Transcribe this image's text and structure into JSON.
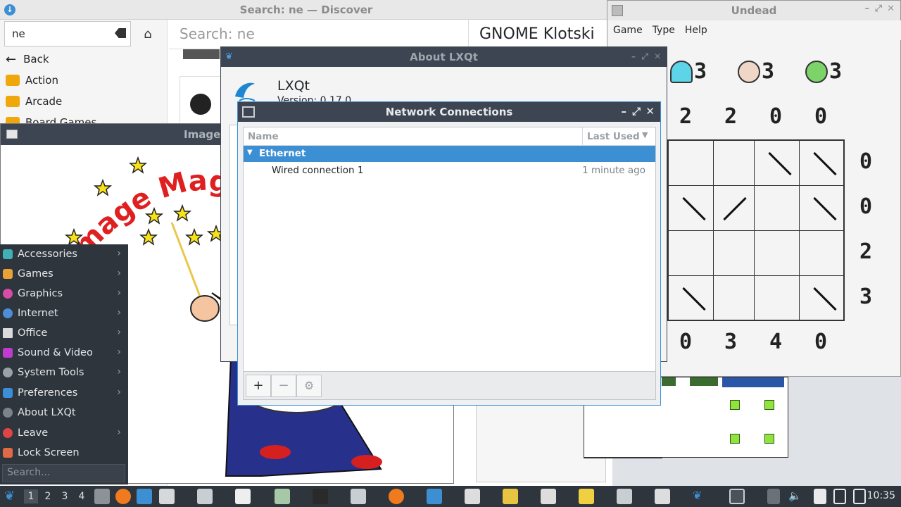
{
  "discover": {
    "title": "Search: ne — Discover",
    "search_value": "ne",
    "nav": [
      {
        "label": "Back",
        "icon": "back-arrow-icon"
      },
      {
        "label": "Action",
        "icon": "gamepad-icon"
      },
      {
        "label": "Arcade",
        "icon": "gamepad-icon"
      },
      {
        "label": "Board Games",
        "icon": "gamepad-icon"
      }
    ],
    "header_query": "Search: ne",
    "app_title": "GNOME Klotski"
  },
  "imagemagick": {
    "title": "Image",
    "banner_text": "mage Magi"
  },
  "menu": {
    "items": [
      {
        "label": "Accessories",
        "icon": "accessories-icon",
        "color": "#3fb0b6"
      },
      {
        "label": "Games",
        "icon": "games-icon",
        "color": "#e8a235"
      },
      {
        "label": "Graphics",
        "icon": "graphics-icon",
        "color": "#d64ca6"
      },
      {
        "label": "Internet",
        "icon": "internet-icon",
        "color": "#4d8ed8"
      },
      {
        "label": "Office",
        "icon": "office-icon",
        "color": "#d8dadd"
      },
      {
        "label": "Sound & Video",
        "icon": "sound-video-icon",
        "color": "#c03bd0"
      },
      {
        "label": "System Tools",
        "icon": "system-tools-icon",
        "color": "#9aa1a8"
      },
      {
        "label": "Preferences",
        "icon": "preferences-icon",
        "color": "#3a8fd8"
      },
      {
        "label": "About LXQt",
        "icon": "info-icon",
        "color": "#7c838b"
      },
      {
        "label": "Leave",
        "icon": "power-icon",
        "color": "#e04545"
      },
      {
        "label": "Lock Screen",
        "icon": "lock-icon",
        "color": "#e06a45"
      }
    ],
    "search_placeholder": "Search..."
  },
  "undead": {
    "title": "Undead",
    "menubar": [
      "Game",
      "Type",
      "Help"
    ],
    "counts": {
      "ghosts": "3",
      "vampires": "3",
      "zombies": "3"
    },
    "top_clues": [
      "2",
      "2",
      "0",
      "0"
    ],
    "right_clues": [
      "0",
      "0",
      "2",
      "3"
    ],
    "bottom_clues": [
      "0",
      "3",
      "4",
      "0"
    ]
  },
  "about": {
    "title": "About LXQt",
    "name": "LXQt",
    "version": "Version: 0.17.0"
  },
  "netconn": {
    "title": "Network Connections",
    "col_name": "Name",
    "col_last_used": "Last Used",
    "group": "Ethernet",
    "connection": {
      "name": "Wired connection 1",
      "last_used": "1 minute ago"
    },
    "buttons": {
      "add": "+",
      "remove": "−",
      "settings": "⚙"
    },
    "accent": "#3d8fd4"
  },
  "taskbar": {
    "desktops": [
      "1",
      "2",
      "3",
      "4"
    ],
    "clock": "10:35"
  }
}
